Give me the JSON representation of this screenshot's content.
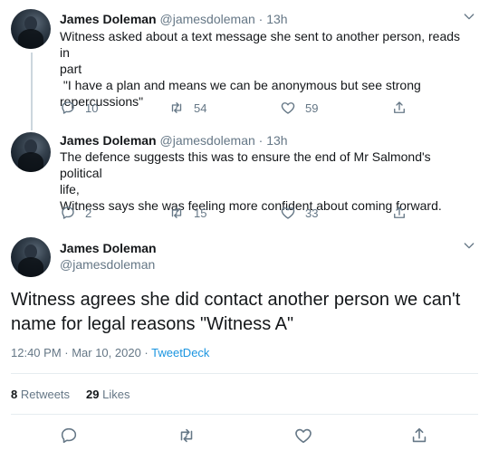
{
  "tweets": [
    {
      "name": "James Doleman",
      "handle": "@jamesdoleman",
      "separator": "·",
      "time": "13h",
      "lines": [
        "Witness asked about a text message she sent to another person, reads in",
        "part",
        " \"I have a plan and means we can be anonymous but see strong",
        "repercussions\""
      ],
      "replies": "10",
      "retweets": "54",
      "likes": "59"
    },
    {
      "name": "James Doleman",
      "handle": "@jamesdoleman",
      "separator": "·",
      "time": "13h",
      "lines": [
        "The defence suggests this was to ensure the end of Mr Salmond's political",
        "life,",
        "Witness says she was feeling more confident about coming forward."
      ],
      "replies": "2",
      "retweets": "15",
      "likes": "33"
    }
  ],
  "main": {
    "name": "James Doleman",
    "handle": "@jamesdoleman",
    "text_lines": [
      "Witness agrees she did contact another person we can't",
      "name for legal reasons \"Witness A\""
    ],
    "timestamp": "12:40 PM · Mar 10, 2020 · ",
    "source": "TweetDeck",
    "retweets_count": "8",
    "retweets_label": " Retweets",
    "likes_count": "29",
    "likes_label": " Likes"
  },
  "icons": {
    "reply": "reply-icon",
    "retweet": "retweet-icon",
    "like": "heart-icon",
    "share": "share-icon",
    "more": "chevron-down-icon"
  },
  "colors": {
    "secondary_text": "#657786",
    "link": "#1b95e0",
    "thread_line": "#ccd6dd"
  }
}
